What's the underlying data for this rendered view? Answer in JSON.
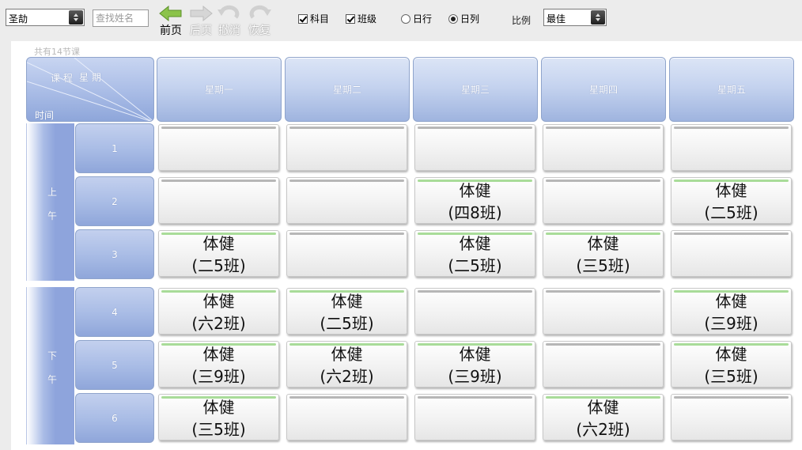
{
  "toolbar": {
    "teacher_select": "圣劼",
    "search_placeholder": "查找姓名",
    "prev_page": "前页",
    "next_page": "后页",
    "undo": "撤消",
    "redo": "恢复",
    "check_subject": "科目",
    "check_class": "班级",
    "radio_day_row": "日行",
    "radio_day_col": "日列",
    "ratio_label": "比例",
    "ratio_select": "最佳"
  },
  "timetable": {
    "lesson_count": "共有14节课",
    "corner": {
      "lesson": "课  程",
      "week": "星  期",
      "time": "时间"
    },
    "days": [
      "星期一",
      "星期二",
      "星期三",
      "星期四",
      "星期五"
    ],
    "morning_label": [
      "上",
      "午"
    ],
    "afternoon_label": [
      "下",
      "午"
    ],
    "periods": [
      "1",
      "2",
      "3",
      "4",
      "5",
      "6"
    ],
    "rows": [
      [
        {
          "subject": "",
          "class": ""
        },
        {
          "subject": "",
          "class": ""
        },
        {
          "subject": "",
          "class": ""
        },
        {
          "subject": "",
          "class": ""
        },
        {
          "subject": "",
          "class": ""
        }
      ],
      [
        {
          "subject": "",
          "class": ""
        },
        {
          "subject": "",
          "class": ""
        },
        {
          "subject": "体健",
          "class": "(四8班)"
        },
        {
          "subject": "",
          "class": ""
        },
        {
          "subject": "体健",
          "class": "(二5班)"
        }
      ],
      [
        {
          "subject": "体健",
          "class": "(二5班)"
        },
        {
          "subject": "",
          "class": ""
        },
        {
          "subject": "体健",
          "class": "(二5班)"
        },
        {
          "subject": "体健",
          "class": "(三5班)"
        },
        {
          "subject": "",
          "class": ""
        }
      ],
      [
        {
          "subject": "体健",
          "class": "(六2班)"
        },
        {
          "subject": "体健",
          "class": "(二5班)"
        },
        {
          "subject": "",
          "class": ""
        },
        {
          "subject": "",
          "class": ""
        },
        {
          "subject": "体健",
          "class": "(三9班)"
        }
      ],
      [
        {
          "subject": "体健",
          "class": "(三9班)"
        },
        {
          "subject": "体健",
          "class": "(六2班)"
        },
        {
          "subject": "体健",
          "class": "(三9班)"
        },
        {
          "subject": "",
          "class": ""
        },
        {
          "subject": "体健",
          "class": "(三5班)"
        }
      ],
      [
        {
          "subject": "体健",
          "class": "(三5班)"
        },
        {
          "subject": "",
          "class": ""
        },
        {
          "subject": "",
          "class": ""
        },
        {
          "subject": "体健",
          "class": "(六2班)"
        },
        {
          "subject": "",
          "class": ""
        }
      ]
    ]
  }
}
